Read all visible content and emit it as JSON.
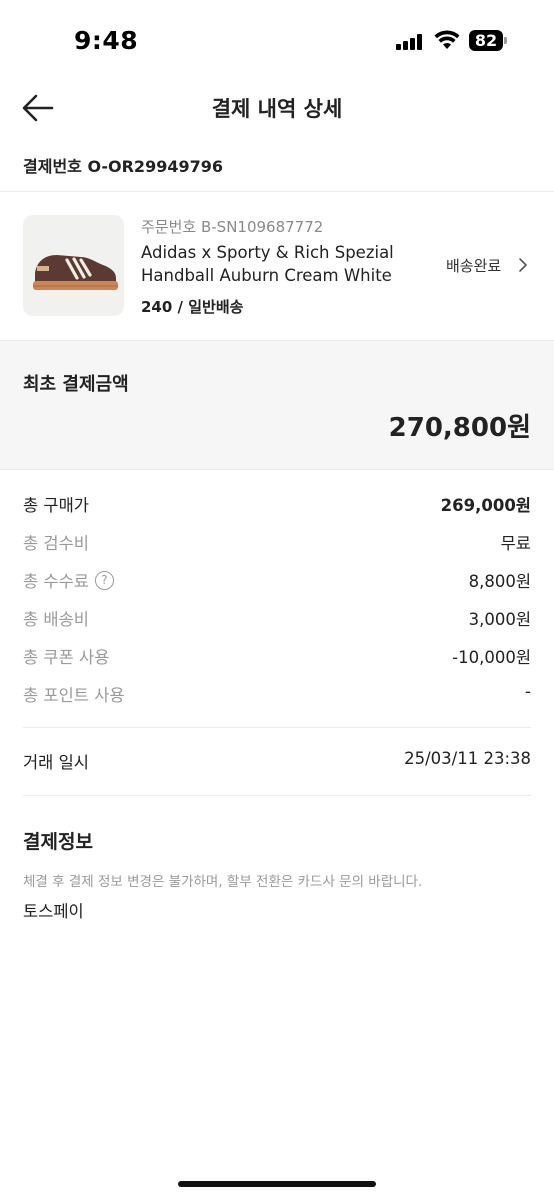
{
  "status_bar": {
    "time": "9:48",
    "battery_level": "82"
  },
  "header": {
    "title": "결제 내역 상세",
    "back_icon": "arrow-left-icon"
  },
  "order": {
    "label": "결제번호",
    "number": "O-OR29949796"
  },
  "product": {
    "sku": "주문번호 B-SN109687772",
    "name_line1": "Adidas x Sporty & Rich Spezial",
    "name_line2": "Handball Auburn Cream White",
    "option": "240 / 일반배송",
    "status": "배송완료",
    "status_icon": "chevron-right-icon"
  },
  "summary": {
    "label": "최초 결제금액",
    "amount": "270,800원"
  },
  "fees": [
    {
      "label": "총 구매가",
      "value": "269,000원"
    },
    {
      "label": "총 검수비",
      "value": "무료"
    },
    {
      "label": "총 수수료",
      "value": "8,800원",
      "help_icon_glyph": "?"
    },
    {
      "label": "총 배송비",
      "value": "3,000원"
    },
    {
      "label": "총 쿠폰 사용",
      "value": "-10,000원"
    },
    {
      "label": "총 포인트 사용",
      "value": "-"
    }
  ],
  "trade": {
    "label": "거래 일시",
    "value": "25/03/11 23:38"
  },
  "payment_info": {
    "title": "결제정보",
    "notice": "체결 후 결제 정보 변경은 불가하며, 할부 전환은 카드사 문의 바랍니다.",
    "method": "토스페이"
  },
  "colors": {
    "text_primary": "#222222",
    "text_secondary": "#9a9a9a",
    "summary_bg": "#f6f6f6",
    "divider": "#ececec",
    "shoe_upper": "#5a3a32",
    "shoe_gum_sole": "#c7875a"
  }
}
